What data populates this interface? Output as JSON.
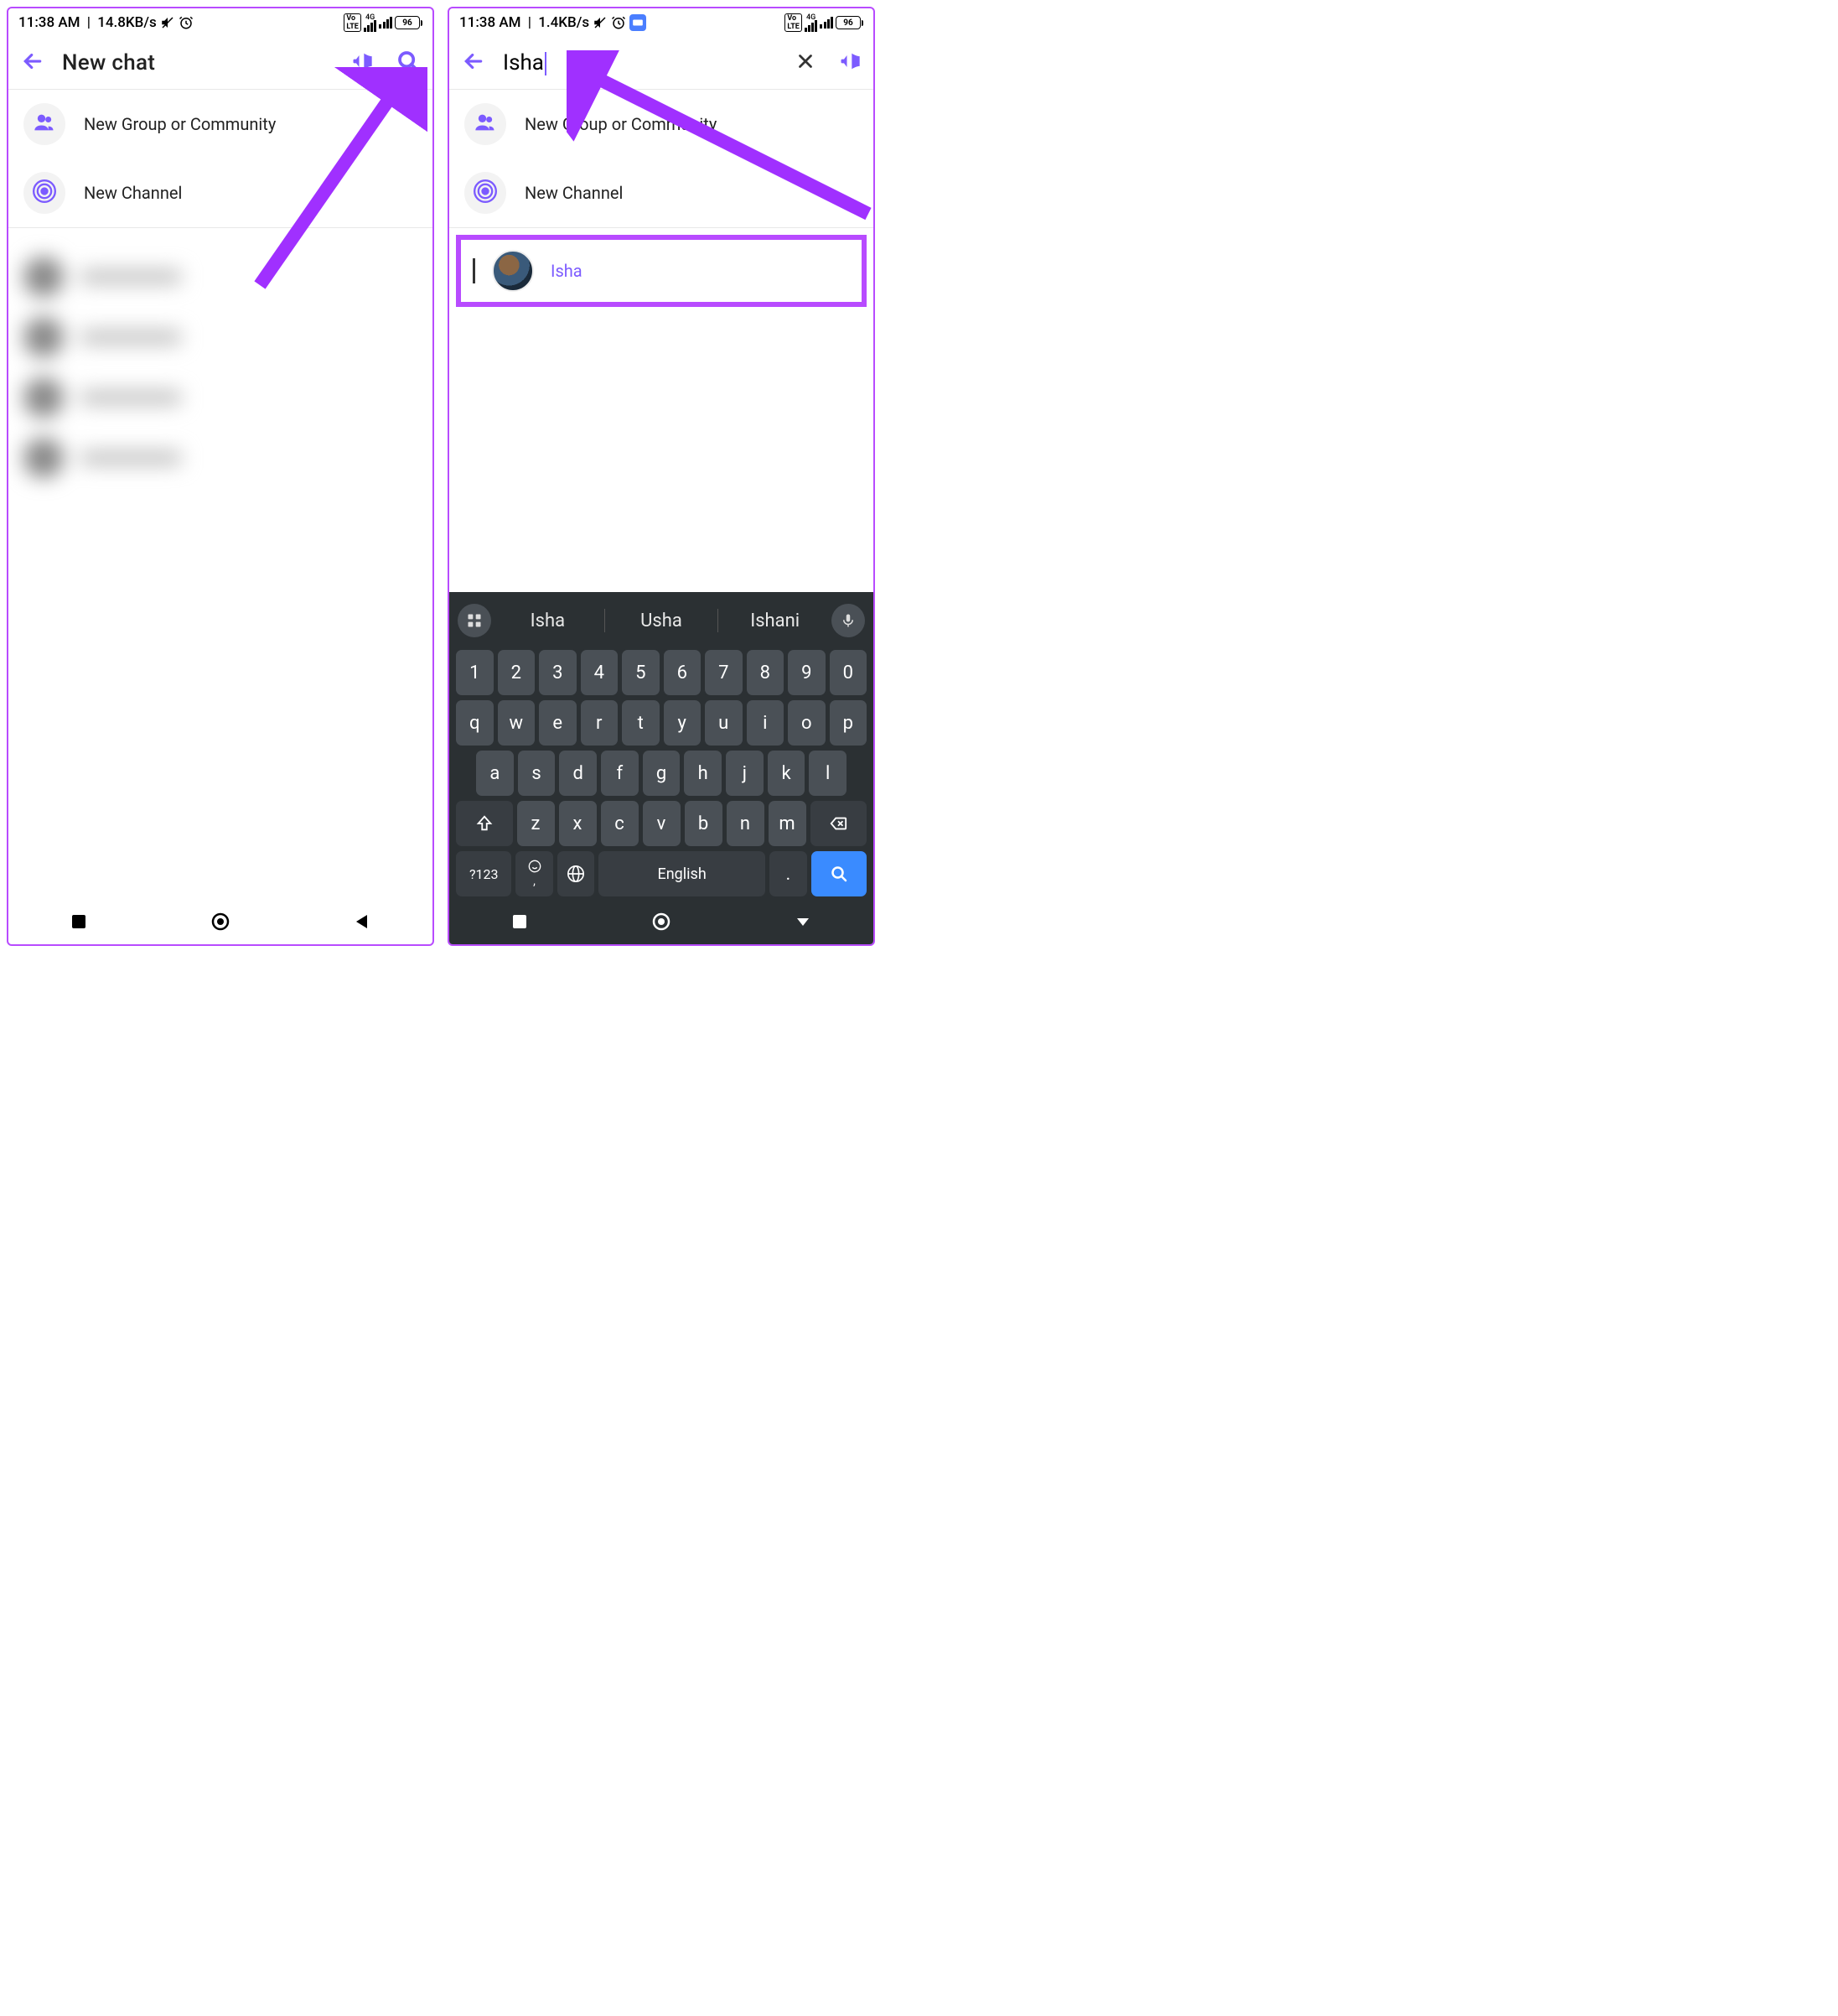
{
  "status_bar": {
    "time": "11:38 AM",
    "net_left": "14.8KB/s",
    "net_right": "1.4KB/s",
    "sig_4g": "4G",
    "battery": "96"
  },
  "left": {
    "title": "New chat",
    "menu_group": "New Group or Community",
    "menu_channel": "New Channel"
  },
  "right": {
    "search_value": "Isha",
    "menu_group": "New Group or Community",
    "menu_channel": "New Channel",
    "result_name": "Isha"
  },
  "keyboard": {
    "suggestions": [
      "Isha",
      "Usha",
      "Ishani"
    ],
    "row1": [
      "1",
      "2",
      "3",
      "4",
      "5",
      "6",
      "7",
      "8",
      "9",
      "0"
    ],
    "row2": [
      "q",
      "w",
      "e",
      "r",
      "t",
      "y",
      "u",
      "i",
      "o",
      "p"
    ],
    "row3": [
      "a",
      "s",
      "d",
      "f",
      "g",
      "h",
      "j",
      "k",
      "l"
    ],
    "row4": [
      "z",
      "x",
      "c",
      "v",
      "b",
      "n",
      "m"
    ],
    "sym": "?123",
    "space": "English",
    "period": "."
  }
}
